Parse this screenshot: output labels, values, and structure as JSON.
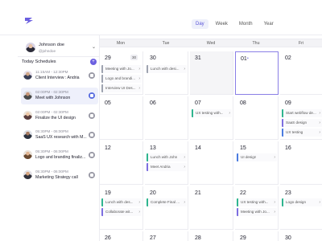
{
  "header": {
    "views": [
      "Day",
      "Week",
      "Month",
      "Year"
    ],
    "active_view": "Day"
  },
  "profile": {
    "name": "Johnson doe",
    "handle": "@johndoe",
    "chevron": "⌄"
  },
  "schedule": {
    "title": "Today Schedules",
    "add_label": "+",
    "items": [
      {
        "time": "11:15AM - 12:30PM",
        "title": "Client Interview : Andria"
      },
      {
        "time": "02:00PM - 02:30PM",
        "title": "Meet with Johnson"
      },
      {
        "time": "02:00PM - 02:30PM",
        "title": "Finalize the UI design"
      },
      {
        "time": "05:30PM - 06:00PM",
        "title": "SaaS UX research with M..."
      },
      {
        "time": "05:30PM - 06:00PM",
        "title": "Logo and branding finaliz..."
      },
      {
        "time": "05:30PM - 06:00PM",
        "title": "Marketing Strategy call"
      }
    ]
  },
  "calendar": {
    "days": [
      "Mon",
      "Tue",
      "Wed",
      "Thu",
      "Fri"
    ],
    "week1": {
      "dates": [
        "29",
        "30",
        "31",
        "01",
        "02"
      ],
      "badge": "30",
      "today_dot": "•",
      "events_mon": [
        "Meeting with Jo...",
        "Logo and brandi...",
        "Interview UI Des..."
      ],
      "events_tue": [
        "Lunch with desi..."
      ]
    },
    "week2": {
      "dates": [
        "05",
        "06",
        "07",
        "08",
        "09"
      ],
      "events_wed": [
        "UX testing with..."
      ],
      "events_fri": [
        "Start webflow de...",
        "SaaS design",
        "UX testing"
      ]
    },
    "week3": {
      "dates": [
        "12",
        "13",
        "14",
        "15",
        "16"
      ],
      "events_tue": [
        "Lunch with John",
        "Meet Andria"
      ],
      "events_thu": [
        "UI design"
      ]
    },
    "week4": {
      "dates": [
        "19",
        "20",
        "21",
        "22",
        "23"
      ],
      "events_mon": [
        "Lunch with des...",
        "Collaborate wit..."
      ],
      "events_tue": [
        "Complete Final ..."
      ],
      "events_thu": [
        "UX testing with...",
        "Meeting with Jo..."
      ],
      "events_fri": [
        "Logo design"
      ]
    },
    "week5": {
      "dates": [
        "26",
        "27",
        "28",
        "29",
        "30"
      ]
    },
    "arrow": "›"
  }
}
